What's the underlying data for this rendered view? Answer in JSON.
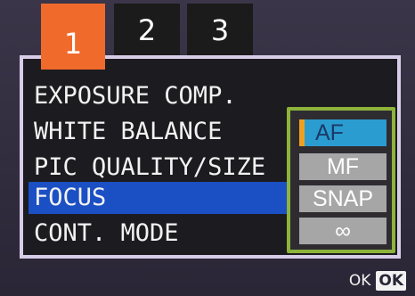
{
  "tabs": [
    {
      "label": "1",
      "active": true
    },
    {
      "label": "2",
      "active": false
    },
    {
      "label": "3",
      "active": false
    }
  ],
  "menu": {
    "items": [
      {
        "label": "EXPOSURE COMP.",
        "selected": false
      },
      {
        "label": "WHITE BALANCE",
        "selected": false
      },
      {
        "label": "PIC QUALITY/SIZE",
        "selected": false
      },
      {
        "label": "FOCUS",
        "selected": true
      },
      {
        "label": "CONT. MODE",
        "selected": false
      }
    ]
  },
  "focus_options": {
    "items": [
      {
        "label": "AF",
        "selected": true
      },
      {
        "label": "MF",
        "selected": false
      },
      {
        "label": "SNAP",
        "selected": false
      },
      {
        "label": "∞",
        "selected": false
      }
    ]
  },
  "footer": {
    "ok_label": "OK",
    "ok_button": "OK"
  },
  "colors": {
    "active_tab": "#f06a2c",
    "selected_row": "#1b4fc4",
    "options_border": "#8db33a",
    "selected_option": "#2a9ccf",
    "option_marker": "#f0a020"
  }
}
